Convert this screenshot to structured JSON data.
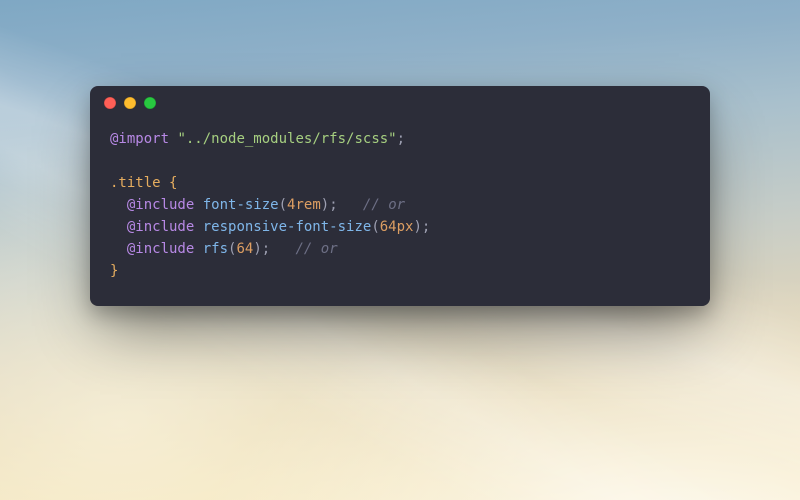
{
  "window": {
    "controls": [
      "close",
      "minimize",
      "zoom"
    ]
  },
  "code": {
    "lines": [
      [
        {
          "t": "@import",
          "c": "keyword"
        },
        {
          "t": " ",
          "c": ""
        },
        {
          "t": "\"../node_modules/rfs/scss\"",
          "c": "string"
        },
        {
          "t": ";",
          "c": "punct"
        }
      ],
      [],
      [
        {
          "t": ".title",
          "c": "selector"
        },
        {
          "t": " ",
          "c": ""
        },
        {
          "t": "{",
          "c": "brace"
        }
      ],
      [
        {
          "t": "  ",
          "c": ""
        },
        {
          "t": "@include",
          "c": "keyword"
        },
        {
          "t": " ",
          "c": ""
        },
        {
          "t": "font-size",
          "c": "func"
        },
        {
          "t": "(",
          "c": "punct"
        },
        {
          "t": "4rem",
          "c": "number"
        },
        {
          "t": ")",
          "c": "punct"
        },
        {
          "t": ";",
          "c": "punct"
        },
        {
          "t": "   ",
          "c": ""
        },
        {
          "t": "// or",
          "c": "comment"
        }
      ],
      [
        {
          "t": "  ",
          "c": ""
        },
        {
          "t": "@include",
          "c": "keyword"
        },
        {
          "t": " ",
          "c": ""
        },
        {
          "t": "responsive-font-size",
          "c": "func"
        },
        {
          "t": "(",
          "c": "punct"
        },
        {
          "t": "64px",
          "c": "number"
        },
        {
          "t": ")",
          "c": "punct"
        },
        {
          "t": ";",
          "c": "punct"
        }
      ],
      [
        {
          "t": "  ",
          "c": ""
        },
        {
          "t": "@include",
          "c": "keyword"
        },
        {
          "t": " ",
          "c": ""
        },
        {
          "t": "rfs",
          "c": "func"
        },
        {
          "t": "(",
          "c": "punct"
        },
        {
          "t": "64",
          "c": "number"
        },
        {
          "t": ")",
          "c": "punct"
        },
        {
          "t": ";",
          "c": "punct"
        },
        {
          "t": "   ",
          "c": ""
        },
        {
          "t": "// or",
          "c": "comment"
        }
      ],
      [
        {
          "t": "}",
          "c": "brace"
        }
      ]
    ]
  }
}
